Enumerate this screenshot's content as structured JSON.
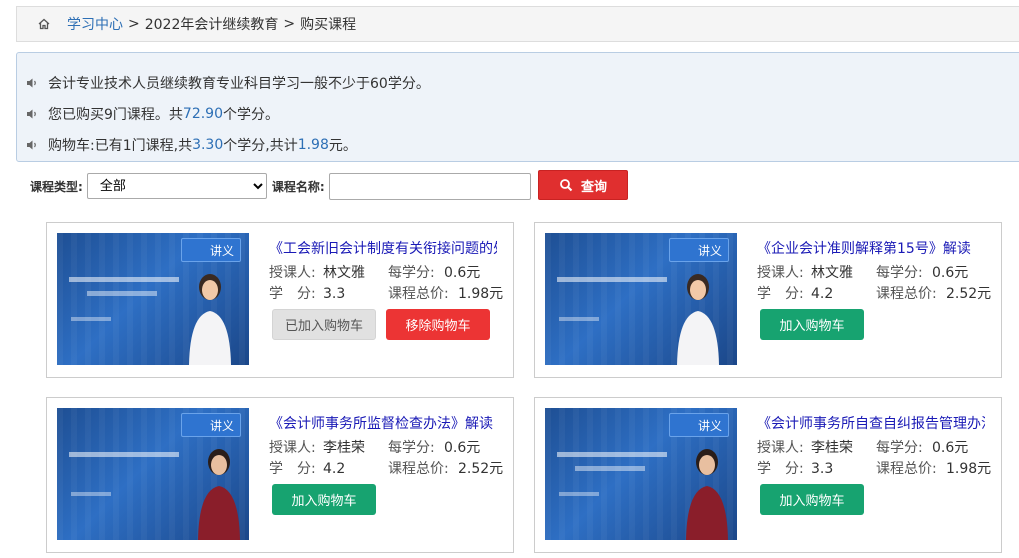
{
  "breadcrumb": {
    "home": "学习中心",
    "sep": ">",
    "level2": "2022年会计继续教育",
    "level3": "购买课程"
  },
  "notice": {
    "line1": "会计专业技术人员继续教育专业科目学习一般不少于60学分。",
    "line2_prefix": "您已购买9门课程。共",
    "line2_credits": "72.90",
    "line2_suffix": "个学分。",
    "line3_prefix": "购物车:已有1门课程,共",
    "line3_credits": "3.30",
    "line3_mid": "个学分,共计",
    "line3_total": "1.98",
    "line3_suffix": "元。"
  },
  "filter": {
    "type_label": "课程类型:",
    "type_value": "全部",
    "name_label": "课程名称:",
    "name_value": "",
    "search_label": "查询"
  },
  "labels": {
    "teacher": "授课人:",
    "credit": "学　分:",
    "per_credit": "每学分:",
    "total": "课程总价:",
    "badge": "讲义"
  },
  "courses": [
    {
      "title": "《工会新旧会计制度有关衔接问题的处理规定》解读",
      "teacher": "林文雅",
      "credits": "3.3",
      "price_per_credit": "0.6元",
      "total_price": "1.98元",
      "state": "in_cart",
      "added_label": "已加入购物车",
      "remove_label": "移除购物车"
    },
    {
      "title": "《企业会计准则解释第15号》解读",
      "teacher": "林文雅",
      "credits": "4.2",
      "price_per_credit": "0.6元",
      "total_price": "2.52元",
      "state": "not_in_cart",
      "add_label": "加入购物车"
    },
    {
      "title": "《会计师事务所监督检查办法》解读",
      "teacher": "李桂荣",
      "credits": "4.2",
      "price_per_credit": "0.6元",
      "total_price": "2.52元",
      "state": "not_in_cart",
      "add_label": "加入购物车"
    },
    {
      "title": "《会计师事务所自查自纠报告管理办法》解读",
      "teacher": "李桂荣",
      "credits": "3.3",
      "price_per_credit": "0.6元",
      "total_price": "1.98元",
      "state": "not_in_cart",
      "add_label": "加入购物车"
    }
  ],
  "colors": {
    "link": "#2d6fb5",
    "title": "#1a1ab6",
    "remove": "#ec3434",
    "add": "#17a370",
    "search": "#e02f2f"
  }
}
